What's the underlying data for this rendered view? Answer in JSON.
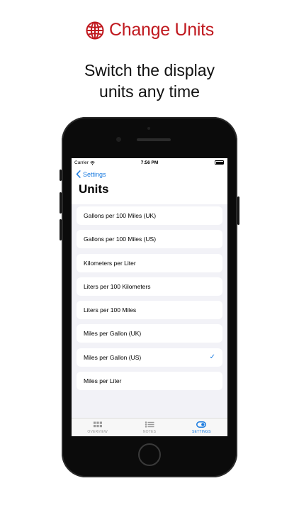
{
  "headline": {
    "title": "Change Units",
    "icon": "globe-icon",
    "color": "#c0191f"
  },
  "subtitle": {
    "line1": "Switch the display",
    "line2": "units any time"
  },
  "status_bar": {
    "carrier": "Carrier",
    "time": "7:56 PM"
  },
  "nav": {
    "back_label": "Settings",
    "title": "Units"
  },
  "units": {
    "selected": "Miles per Gallon (US)",
    "items": [
      {
        "label": "Gallons per 100 Miles (UK)"
      },
      {
        "label": "Gallons per 100 Miles (US)"
      },
      {
        "label": "Kilometers per Liter"
      },
      {
        "label": "Liters per 100 Kilometers"
      },
      {
        "label": "Liters per 100 Miles"
      },
      {
        "label": "Miles per Gallon (UK)"
      },
      {
        "label": "Miles per Gallon (US)",
        "check": "✓"
      },
      {
        "label": "Miles per Liter"
      }
    ]
  },
  "tab_bar": {
    "active": "SETTINGS",
    "tabs": [
      {
        "label": "OVERVIEW",
        "icon": "grid-icon"
      },
      {
        "label": "NOTES",
        "icon": "list-icon"
      },
      {
        "label": "SETTINGS",
        "icon": "toggle-icon"
      }
    ]
  },
  "colors": {
    "accent": "#1a7be0",
    "brand": "#c0191f",
    "list_background": "#f2f2f7"
  }
}
